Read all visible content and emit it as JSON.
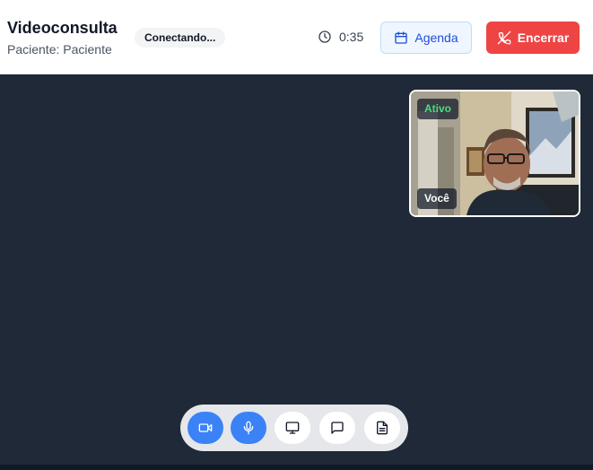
{
  "header": {
    "title": "Videoconsulta",
    "subtitle": "Paciente: Paciente",
    "status": "Conectando...",
    "timer": "0:35",
    "agenda_label": "Agenda",
    "end_label": "Encerrar"
  },
  "self_view": {
    "active_label": "Ativo",
    "self_label": "Você"
  },
  "controls": [
    {
      "name": "camera",
      "icon": "video-icon",
      "active": true
    },
    {
      "name": "microphone",
      "icon": "mic-icon",
      "active": true
    },
    {
      "name": "screen-share",
      "icon": "monitor-icon",
      "active": false
    },
    {
      "name": "chat",
      "icon": "chat-icon",
      "active": false
    },
    {
      "name": "notes",
      "icon": "document-icon",
      "active": false
    }
  ],
  "colors": {
    "accent": "#3b82f6",
    "danger": "#ef4444",
    "stage": "#1f2937",
    "active_text": "#4ade80"
  }
}
